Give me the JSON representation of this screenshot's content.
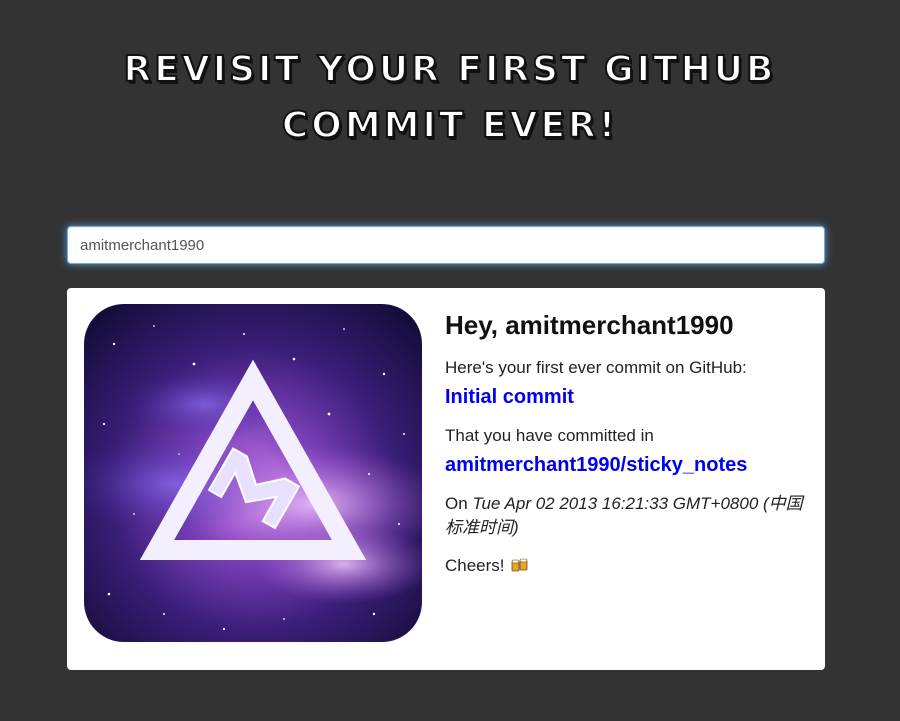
{
  "header": {
    "title_line1": "Revisit your first GitHub",
    "title_line2": "Commit ever!"
  },
  "search": {
    "value": "amitmerchant1990",
    "placeholder": ""
  },
  "result": {
    "greeting_prefix": "Hey, ",
    "username": "amitmerchant1990",
    "first_commit_text": "Here's your first ever commit on GitHub:",
    "commit_message": "Initial commit",
    "committed_in_text": "That you have committed in",
    "repository": "amitmerchant1990/sticky_notes",
    "date_prefix": "On ",
    "date": "Tue Apr 02 2013 16:21:33 GMT+0800 (中国标准时间)",
    "closing": "Cheers!",
    "closing_icon": "beer-mugs-icon",
    "avatar_icon": "triangle-m-logo-icon"
  },
  "colors": {
    "page_background": "#333333",
    "card_background": "#ffffff",
    "link": "#0000ee",
    "input_focus_glow": "#66afe9"
  }
}
